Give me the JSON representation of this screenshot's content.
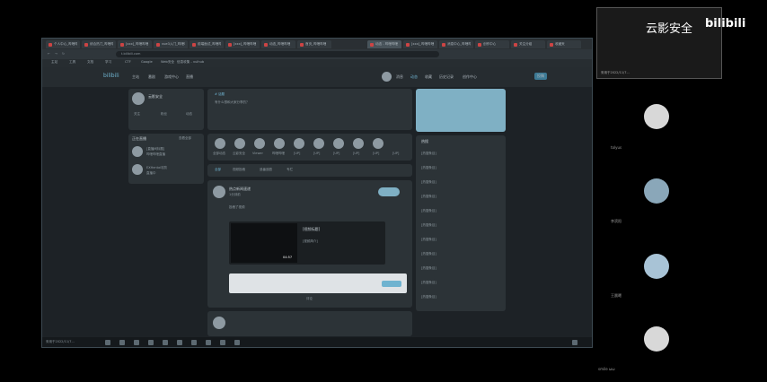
{
  "tabs": [
    "个人中心_哔哩哔哩",
    "综合热门_哔哩哔哩",
    "[xxx]_哔哩哔哩",
    "vue3入门_哔哩哔哩",
    "前端面试_哔哩哔哩",
    "[xxx]_哔哩哔哩",
    "动态_哔哩哔哩",
    "首页_哔哩哔哩",
    "[xxx]_哔哩哔哩",
    "消息中心_哔哩哔哩",
    "创作中心",
    "关注分组",
    "收藏夹"
  ],
  "active_tab": "动态 - 哔哩哔哩",
  "url": "t.bilibili.com",
  "bookmarks": [
    "主站",
    "工具",
    "文档",
    "学习",
    "CTF",
    "Google",
    "Web安全",
    "信息收集 - vulhub"
  ],
  "site_nav": {
    "logo": "bilibili",
    "items": [
      "主站",
      "番剧",
      "游戏中心",
      "直播"
    ],
    "right": [
      "消息",
      "动态",
      "收藏",
      "历史记录",
      "创作中心",
      "投稿"
    ]
  },
  "profile": {
    "name": "云影安全",
    "stats": [
      "关注",
      "粉丝",
      "动态"
    ]
  },
  "live_title": "正在直播",
  "live_more": "查看全部",
  "live_items": [
    {
      "name": "[直播间标题]",
      "sub": "哔哩哔哩直播"
    },
    {
      "name": "EXHentai攻防",
      "sub": "直播中"
    }
  ],
  "composer": {
    "topic": "# 话题",
    "placeholder": "有什么想和大家分享的？"
  },
  "up_items": [
    "全部动态",
    "云影安全",
    "Viewer",
    "哔哩哔哩",
    "[UP]",
    "[UP]",
    "[UP]",
    "[UP]",
    "[UP]",
    "[UP]"
  ],
  "feed_tabs": [
    "全部",
    "视频投稿",
    "追番追剧",
    "专栏"
  ],
  "post": {
    "author": "热点新闻速递",
    "time": "1分钟前",
    "follow": "投稿了视频",
    "title": "[视频标题]",
    "desc": "[视频简介]",
    "duration": "04:57",
    "comment_label": "评论"
  },
  "trending_title": "热搜",
  "trending": [
    "[热搜条目]",
    "[热搜条目]",
    "[热搜条目]",
    "[热搜条目]",
    "[热搜条目]",
    "[热搜条目]",
    "[热搜条目]",
    "[热搜条目]",
    "[热搜条目]",
    "[热搜条目]",
    "[热搜条目]"
  ],
  "taskbar_text": "采用于2022/11/7...",
  "speaker": {
    "brand": "云影安全",
    "logo": "bilibili",
    "name": "采用于2022/11/7..."
  },
  "participants": [
    "tolyus",
    "[参会者]",
    "李滨阳",
    "王晨曦",
    "smile ωω"
  ],
  "colors": {
    "accent": "#6fb3d0",
    "banner": "#7fb0c4"
  }
}
